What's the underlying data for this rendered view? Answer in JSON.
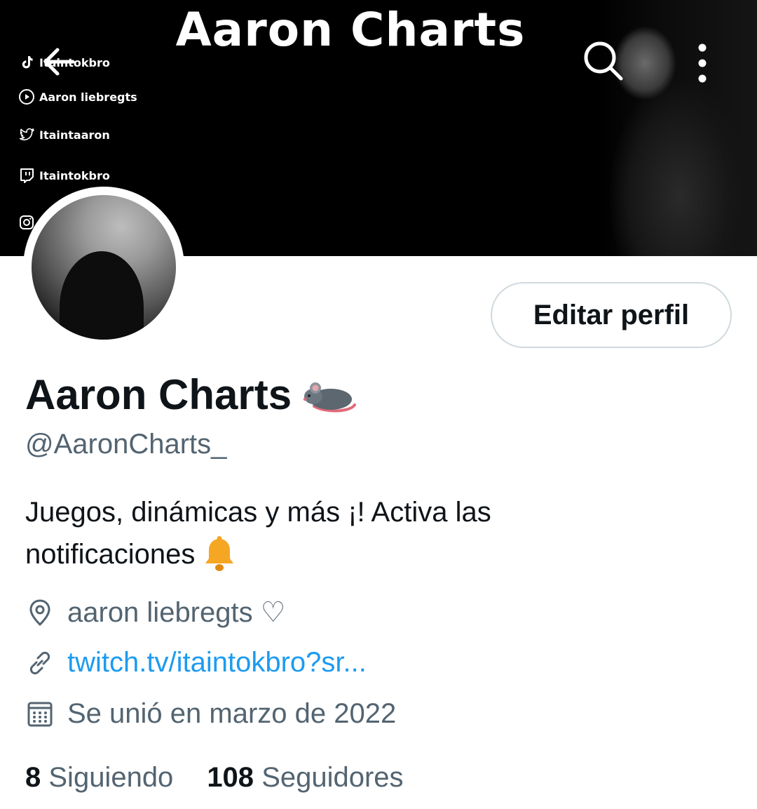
{
  "banner": {
    "title": "Aaron Charts",
    "socials": [
      {
        "icon": "tiktok-icon",
        "label": "Itaintokbro"
      },
      {
        "icon": "youtube-icon",
        "label": "Aaron liebregts"
      },
      {
        "icon": "twitter-icon",
        "label": "Itaintaaron"
      },
      {
        "icon": "twitch-icon",
        "label": "Itaintokbro"
      },
      {
        "icon": "instagram-icon",
        "label": ""
      }
    ]
  },
  "nav": {
    "back_icon": "back-arrow-icon",
    "search_icon": "search-icon",
    "more_icon": "more-vertical-icon"
  },
  "profile": {
    "edit_label": "Editar perfil",
    "name": "Aaron Charts",
    "name_emoji": "rat-emoji",
    "handle": "@AaronCharts_",
    "bio_line1": "Juegos, dinámicas y más ¡! Activa las",
    "bio_line2": "notificaciones",
    "bio_emoji": "bell-emoji",
    "location": "aaron liebregts ♡",
    "link": "twitch.tv/itaintokbro?sr...",
    "joined": "Se unió en marzo de 2022",
    "following_count": "8",
    "following_label": "Siguiendo",
    "followers_count": "108",
    "followers_label": "Seguidores"
  },
  "colors": {
    "accent": "#1d9bf0",
    "text": "#0f1419",
    "secondary": "#536471",
    "border": "#cfd9de"
  }
}
